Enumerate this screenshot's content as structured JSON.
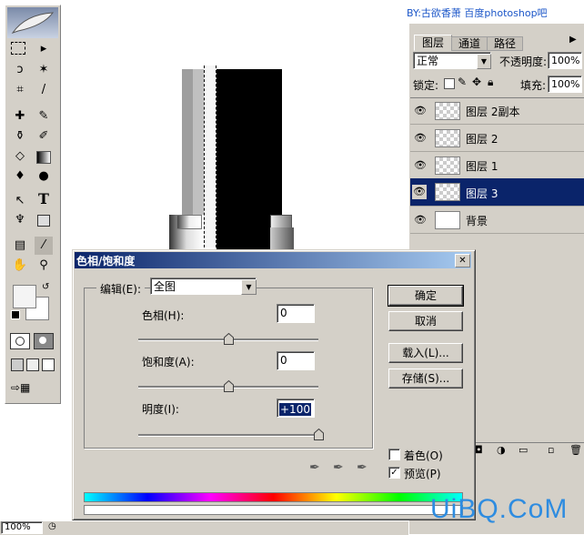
{
  "watermark_top": "BY:古欲香萧  百度photoshop吧",
  "watermark_bottom": "UiBQ.CoM",
  "layers_panel": {
    "tabs": [
      "图层",
      "通道",
      "路径"
    ],
    "blend_mode": "正常",
    "opacity_label": "不透明度:",
    "opacity_value": "100%",
    "lock_label": "锁定:",
    "fill_label": "填充:",
    "fill_value": "100%",
    "layers": [
      {
        "name": "图层 2副本",
        "selected": false
      },
      {
        "name": "图层 2",
        "selected": false
      },
      {
        "name": "图层 1",
        "selected": false
      },
      {
        "name": "图层 3",
        "selected": true
      },
      {
        "name": "背景",
        "selected": false
      }
    ]
  },
  "dialog": {
    "title": "色相/饱和度",
    "edit_label": "编辑(E):",
    "edit_value": "全图",
    "hue_label": "色相(H):",
    "hue_value": "0",
    "hue_level": 0.5,
    "saturation_label": "饱和度(A):",
    "saturation_value": "0",
    "saturation_level": 0.5,
    "lightness_label": "明度(I):",
    "lightness_value": "+100",
    "lightness_level": 1.0,
    "ok_label": "确定",
    "cancel_label": "取消",
    "load_label": "载入(L)...",
    "save_label": "存储(S)...",
    "colorize_label": "着色(O)",
    "colorize_checked": false,
    "preview_label": "预览(P)",
    "preview_checked": true
  },
  "status_bar": {
    "zoom": "100%"
  }
}
